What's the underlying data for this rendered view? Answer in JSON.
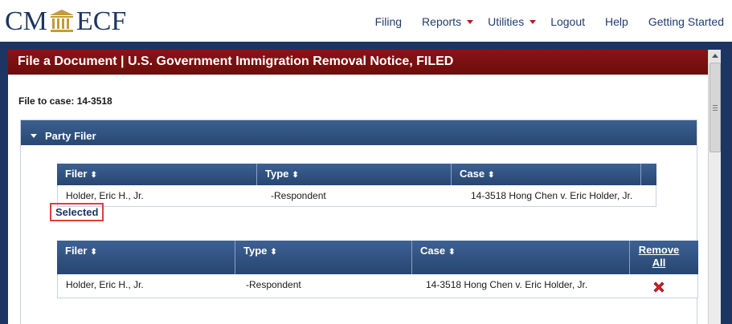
{
  "brand": {
    "logo_left": "CM",
    "logo_right": "ECF"
  },
  "nav": {
    "filing": "Filing",
    "reports": "Reports",
    "utilities": "Utilities",
    "logout": "Logout",
    "help": "Help",
    "getting_started": "Getting Started"
  },
  "page": {
    "title": "File a Document | U.S. Government Immigration Removal Notice, FILED",
    "file_to_case": "File to case: 14-3518"
  },
  "party_panel": {
    "title": "Party Filer"
  },
  "filer_table": {
    "headers": [
      "Filer",
      "Type",
      "Case"
    ],
    "sort_glyph": "⬍",
    "rows": [
      {
        "filer": "Holder, Eric H., Jr.",
        "type": "-Respondent",
        "case": "14-3518 Hong Chen v. Eric Holder, Jr."
      }
    ]
  },
  "selected": {
    "label": "Selected",
    "headers": [
      "Filer",
      "Type",
      "Case"
    ],
    "remove_all_line1": "Remove",
    "remove_all_line2": "All",
    "rows": [
      {
        "filer": "Holder, Eric H., Jr.",
        "type": "-Respondent",
        "case": "14-3518 Hong Chen v. Eric Holder, Jr."
      }
    ]
  },
  "colors": {
    "navy": "#1d3563",
    "maroon": "#7a1010",
    "header_blue": "#2f5282",
    "accent_red": "#c0161e"
  },
  "icons": {
    "logo": "courthouse-pillar-icon",
    "nav_dropdown": "caret-down-icon",
    "panel_toggle": "triangle-down-icon",
    "sort": "sort-icon",
    "remove": "red-x-icon"
  }
}
